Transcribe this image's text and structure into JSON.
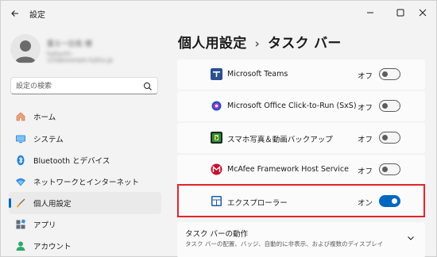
{
  "window": {
    "title": "設定",
    "controls": [
      "minimize-icon",
      "maximize-icon",
      "close-icon"
    ]
  },
  "profile": {
    "name": "富士一比佐 様",
    "email": "fujitsu01-123@example.fujitsu.jp"
  },
  "search": {
    "placeholder": "設定の検索",
    "value": ""
  },
  "sidebar": {
    "items": [
      {
        "label": "ホーム",
        "icon": "home-icon",
        "selected": false
      },
      {
        "label": "システム",
        "icon": "monitor-icon",
        "selected": false
      },
      {
        "label": "Bluetooth とデバイス",
        "icon": "bluetooth-icon",
        "selected": false
      },
      {
        "label": "ネットワークとインターネット",
        "icon": "wifi-icon",
        "selected": false
      },
      {
        "label": "個人用設定",
        "icon": "brush-icon",
        "selected": true
      },
      {
        "label": "アプリ",
        "icon": "apps-icon",
        "selected": false
      },
      {
        "label": "アカウント",
        "icon": "account-icon",
        "selected": false
      }
    ]
  },
  "breadcrumb": {
    "parent": "個人用設定",
    "separator": "›",
    "current": "タスク バー"
  },
  "overflow_items": [
    {
      "name": "Microsoft Teams",
      "icon": "teams-icon",
      "state": "オフ",
      "on": false
    },
    {
      "name": "Microsoft Office Click-to-Run (SxS)",
      "icon": "office-icon",
      "state": "オフ",
      "on": false
    },
    {
      "name": "スマホ写真＆動画バックアップ",
      "icon": "photo-backup-icon",
      "state": "オフ",
      "on": false
    },
    {
      "name": "McAfee Framework Host Service",
      "icon": "mcafee-icon",
      "state": "オフ",
      "on": false
    },
    {
      "name": "エクスプローラー",
      "icon": "explorer-icon",
      "state": "オン",
      "on": true
    }
  ],
  "behavior_section": {
    "title": "タスク バーの動作",
    "description": "タスク バーの配置、バッジ、自動的に非表示、および複数のディスプレイ"
  },
  "colors": {
    "accent": "#0067c0",
    "highlight": "#e5232b"
  }
}
